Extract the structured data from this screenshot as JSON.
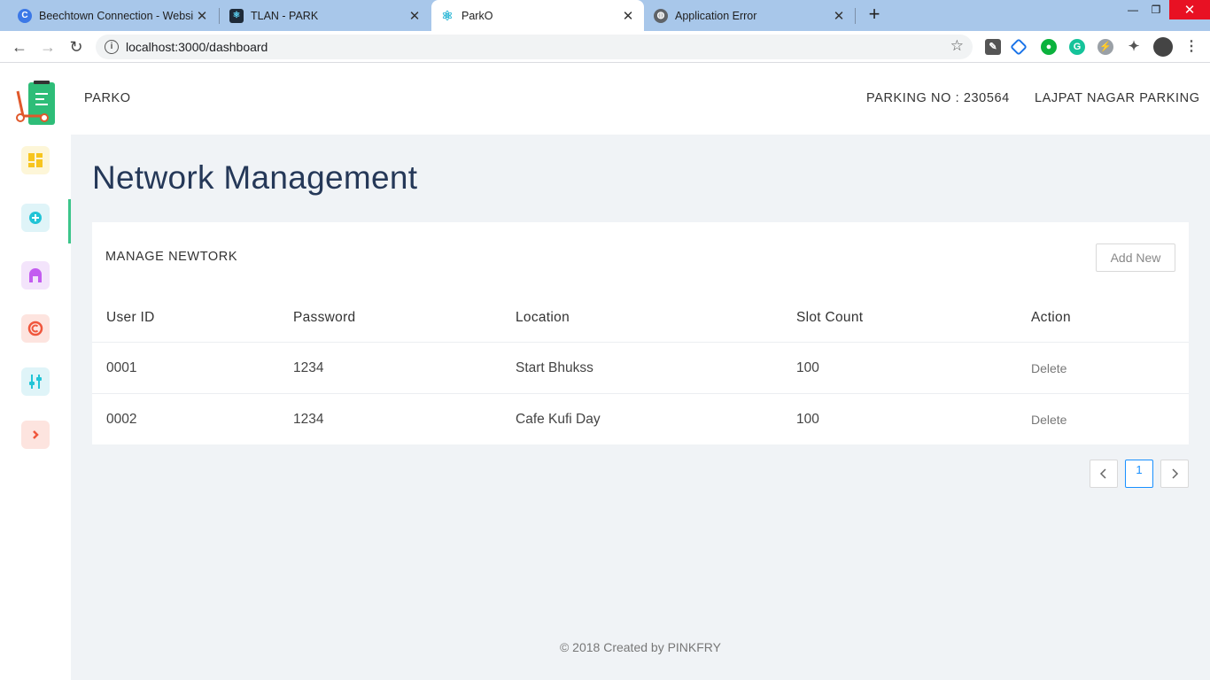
{
  "browser": {
    "tabs": [
      {
        "title": "Beechtown Connection - Website",
        "favicon": "c-circle-icon"
      },
      {
        "title": "TLAN - PARK",
        "favicon": "react-icon"
      },
      {
        "title": "ParkO",
        "favicon": "react-icon"
      },
      {
        "title": "Application Error",
        "favicon": "globe-icon"
      }
    ],
    "url": "localhost:3000/dashboard"
  },
  "app": {
    "brand": "PARKO",
    "parking_no": "PARKING NO : 230564",
    "parking_name": "LAJPAT NAGAR PARKING",
    "sidebar": [
      {
        "icon": "dashboard-icon",
        "color": "#f7c51e"
      },
      {
        "icon": "add-circle-icon",
        "color": "#21c4d6"
      },
      {
        "icon": "garage-icon",
        "color": "#c35cf0"
      },
      {
        "icon": "copyright-icon",
        "color": "#f0563c"
      },
      {
        "icon": "sliders-icon",
        "color": "#21c4d6"
      },
      {
        "icon": "chevron-right-icon",
        "color": "#f0563c"
      }
    ]
  },
  "page": {
    "title": "Network Management",
    "card_title": "MANAGE NEWTORK",
    "add_button": "Add New",
    "columns": [
      "User ID",
      "Password",
      "Location",
      "Slot Count",
      "Action"
    ],
    "rows": [
      {
        "user_id": "0001",
        "password": "1234",
        "location": "Start Bhukss",
        "slot_count": "100",
        "action": "Delete"
      },
      {
        "user_id": "0002",
        "password": "1234",
        "location": "Cafe Kufi Day",
        "slot_count": "100",
        "action": "Delete"
      }
    ],
    "pagination": {
      "prev": "<",
      "current": "1",
      "next": ">"
    },
    "footer": "© 2018 Created by PINKFRY"
  }
}
